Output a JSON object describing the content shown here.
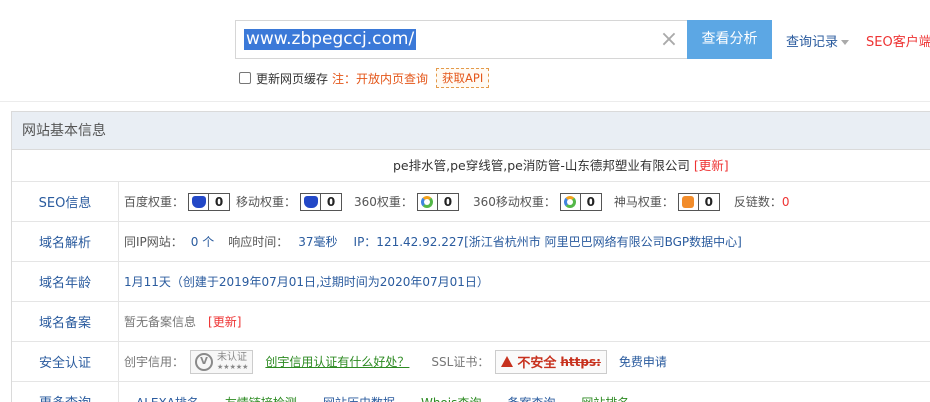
{
  "search": {
    "value": "www.zbpegccj.com/",
    "clear_glyph": "×",
    "button": "查看分析"
  },
  "header": {
    "history": "查询记录",
    "seo_client": "SEO客户端"
  },
  "options": {
    "refresh_cache": "更新网页缓存",
    "note": "注：开放内页查询",
    "api": "获取API"
  },
  "panel": {
    "title": "网站基本信息",
    "site_title": "pe排水管,pe穿线管,pe消防管-山东德邦塑业有限公司",
    "update": "[更新]"
  },
  "seo": {
    "label": "SEO信息",
    "baidu_label": "百度权重：",
    "baidu_value": "0",
    "mobile_label": "移动权重：",
    "mobile_value": "0",
    "s360_label": "360权重：",
    "s360_value": "0",
    "s360m_label": "360移动权重：",
    "s360m_value": "0",
    "shenma_label": "神马权重：",
    "shenma_value": "0",
    "backlinks_label": "反链数：",
    "backlinks_value": "0"
  },
  "dns": {
    "label": "域名解析",
    "same_ip_label": "同IP网站：",
    "same_ip_value": "0 个",
    "resp_label": "响应时间：",
    "resp_value": "37毫秒",
    "ip_text": "IP：121.42.92.227[浙江省杭州市 阿里巴巴网络有限公司BGP数据中心]"
  },
  "age": {
    "label": "域名年龄",
    "value": "1月11天（创建于2019年07月01日,过期时间为2020年07月01日）"
  },
  "icp": {
    "label": "域名备案",
    "value": "暂无备案信息",
    "update": "[更新]"
  },
  "security": {
    "label": "安全认证",
    "chuangyu_label": "创宇信用：",
    "cert_text": "未认证",
    "cert_stars": "★★★★★",
    "chuangyu_link": "创宇信用认证有什么好处？",
    "ssl_label": "SSL证书：",
    "ssl_warn": "不安全",
    "ssl_https": "https:",
    "ssl_apply": "免费申请"
  },
  "more": {
    "label": "更多查询",
    "links": [
      "ALEXA排名",
      "友情链接检测",
      "网站历史数据",
      "Whois查询",
      "备案查询",
      "网站排名"
    ]
  }
}
